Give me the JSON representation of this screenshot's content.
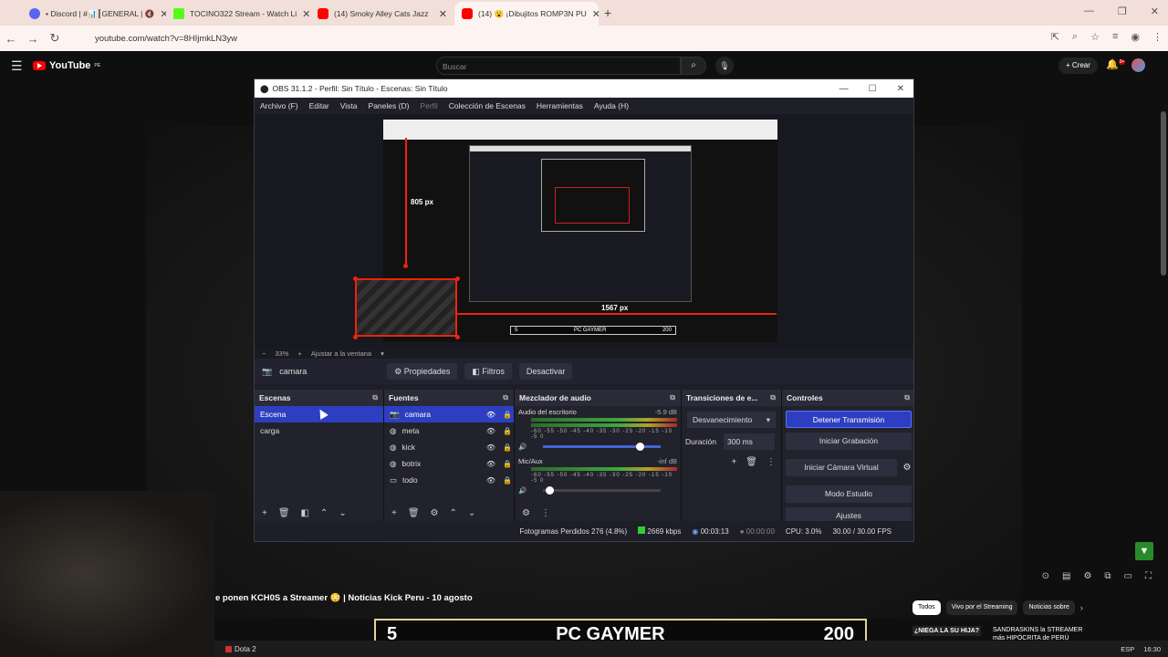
{
  "browser": {
    "tabs": [
      {
        "label": "• Discord | #📊┃GENERAL | 🔇",
        "color": "#5865f2"
      },
      {
        "label": "TOCINO322 Stream - Watch Li",
        "color": "#53fc18"
      },
      {
        "label": "(14) Smoky Alley Cats Jazz",
        "color": "#ff0000"
      },
      {
        "label": "(14) 😮 ¡Dibujitos ROMP3N PU",
        "color": "#ff0000"
      }
    ],
    "url": "youtube.com/watch?v=8HIjmkLN3yw"
  },
  "youtube": {
    "logo": "YouTube",
    "region": "PE",
    "search_placeholder": "Buscar",
    "create_label": "Crear",
    "notif_count": "9+",
    "video_title": "e ponen KCH0S a Streamer 😳 | Noticias Kick Peru - 10 agosto",
    "chips": [
      "Todos",
      "Vivo por el Streaming",
      "Noticias sobre"
    ],
    "rec1": "¿NIEGA LA SU HIJA?",
    "rec2": "SANDRASKINS la STREAMER más HIPÓCRITA de PERÚ"
  },
  "obs": {
    "title": "OBS 31.1.2 - Perfil: Sin Título - Escenas: Sin Título",
    "menu": [
      "Archivo (F)",
      "Editar",
      "Vista",
      "Paneles (D)",
      "Perfil",
      "Colección de Escenas",
      "Herramientas",
      "Ayuda (H)"
    ],
    "measure_vertical": "805 px",
    "measure_horizontal": "1567 px",
    "zoom": "33%",
    "fit_label": "Ajustar a la ventana",
    "selected_source": "camara",
    "properties_label": "Propiedades",
    "filters_label": "Filtros",
    "deactivate_label": "Desactivar",
    "scenes": {
      "title": "Escenas",
      "items": [
        "Escena",
        "carga"
      ]
    },
    "sources": {
      "title": "Fuentes",
      "items": [
        "camara",
        "meta",
        "kick",
        "botrix",
        "todo"
      ]
    },
    "mixer": {
      "title": "Mezclador de audio",
      "channels": [
        {
          "name": "Audio del escritorio",
          "db": "-5.9 dB",
          "level": 0.82
        },
        {
          "name": "Mic/Aux",
          "db": "-inf dB",
          "level": 0.05
        }
      ],
      "ticks": "-60 -55 -50 -45 -40 -35 -30 -25 -20 -15 -10 -5 0"
    },
    "transitions": {
      "title": "Transiciones de e...",
      "selected": "Desvanecimiento",
      "duration_label": "Duración",
      "duration": "300 ms"
    },
    "controls": {
      "title": "Controles",
      "buttons": [
        "Detener Transmisión",
        "Iniciar Grabación",
        "Iniciar Cámara Virtual",
        "Modo Estudio",
        "Ajustes"
      ]
    },
    "status": {
      "dropped": "Fotogramas Perdidos 276 (4.8%)",
      "bitrate": "2669 kbps",
      "stream_time": "00:03:13",
      "rec_time": "00:00:00",
      "cpu": "CPU: 3.0%",
      "fps": "30.00 / 30.00 FPS"
    },
    "mini_overlay": {
      "left": "5",
      "center": "PC GAYMER",
      "right": "200"
    }
  },
  "overlay": {
    "left": "5",
    "center": "PC GAYMER",
    "right": "200"
  },
  "taskbar": {
    "app": "Dota 2",
    "lang": "ESP",
    "time": "16:30"
  }
}
